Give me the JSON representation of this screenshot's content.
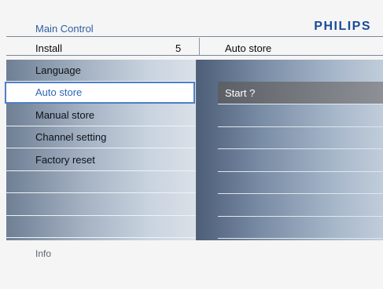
{
  "header": {
    "breadcrumb": "Main Control",
    "brand": "PHILIPS"
  },
  "submenu_header": {
    "left_label": "Install",
    "left_value": "5",
    "right_label": "Auto store"
  },
  "menu": {
    "items": [
      {
        "label": "Language"
      },
      {
        "label": "Auto store"
      },
      {
        "label": "Manual store"
      },
      {
        "label": "Channel setting"
      },
      {
        "label": "Factory reset"
      },
      {
        "label": ""
      },
      {
        "label": ""
      },
      {
        "label": ""
      }
    ],
    "active_index": 1
  },
  "right_panel": {
    "rows": [
      {
        "label": ""
      },
      {
        "label": "Start ?"
      },
      {
        "label": ""
      },
      {
        "label": ""
      },
      {
        "label": ""
      },
      {
        "label": ""
      },
      {
        "label": ""
      },
      {
        "label": ""
      }
    ],
    "selected_index": 1
  },
  "footer": {
    "info_label": "Info"
  },
  "colors": {
    "brand": "#1a4b9a",
    "accent": "#2f66b6",
    "selection_bg": "#ffffff",
    "highlight_row": "#75787d"
  }
}
